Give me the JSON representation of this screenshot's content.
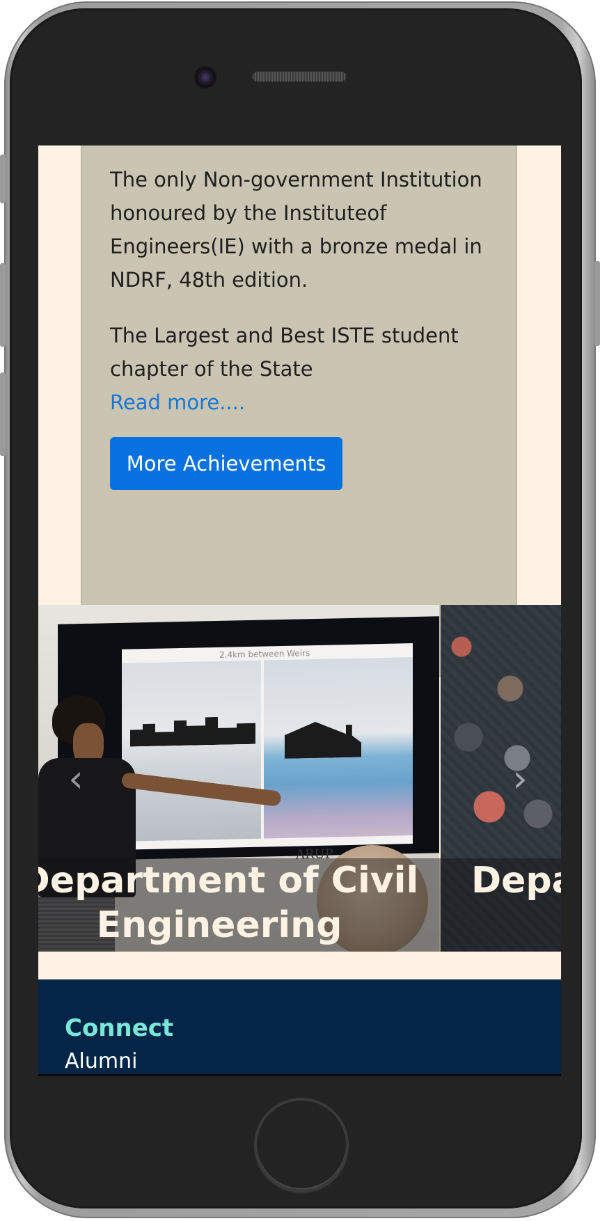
{
  "achievements": {
    "paragraph_1": "The only Non-government Institution honoured by the Instituteof Engineers(IE) with a bronze medal in NDRF, 48th edition.",
    "paragraph_2": "The Largest and Best ISTE student chapter of the State",
    "read_more": "Read more....",
    "more_button": "More Achievements"
  },
  "carousel": {
    "slides": [
      {
        "title_line_1": "Department of Civil",
        "title_line_2": "Engineering",
        "image_text_1": "2.4km between Weirs",
        "image_text_2": "ARUP"
      },
      {
        "title": "Depa"
      }
    ],
    "prev_arrow": "‹",
    "next_arrow": "›"
  },
  "footer": {
    "heading": "Connect",
    "links": [
      "Alumni"
    ]
  },
  "colors": {
    "page_background": "#fdf2e3",
    "card_background": "#cac4b2",
    "accent_button": "#0771e0",
    "link": "#1677d8",
    "footer_background": "#032648",
    "footer_heading": "#7be7d8"
  }
}
